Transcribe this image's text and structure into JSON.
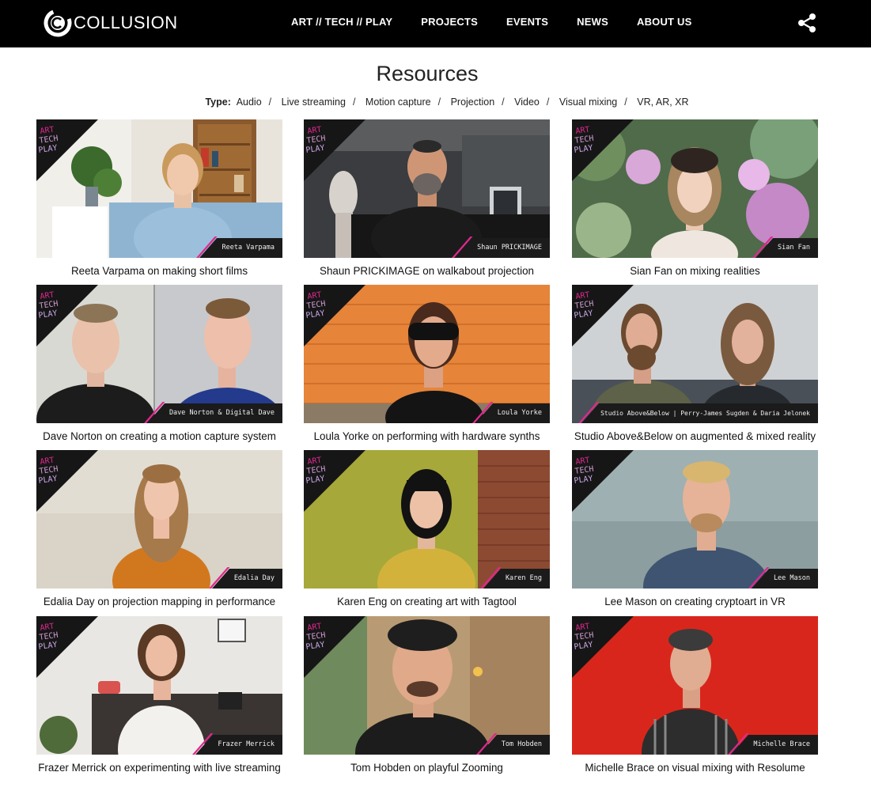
{
  "site": {
    "logo_text": "COLLUSION",
    "nav": [
      "ART // TECH // PLAY",
      "PROJECTS",
      "EVENTS",
      "NEWS",
      "ABOUT US"
    ],
    "share_icon": "share-icon"
  },
  "page": {
    "title": "Resources",
    "filter_label": "Type:",
    "filters": [
      "Audio",
      "Live streaming",
      "Motion capture",
      "Projection",
      "Video",
      "Visual mixing",
      "VR, AR, XR"
    ]
  },
  "badge_text": [
    "ART",
    "TECH",
    "PLAY"
  ],
  "colors": {
    "header_bg": "#000000",
    "accent_pink": "#e0288f",
    "tag_bg": "#1b1b1b"
  },
  "resources": [
    {
      "title": "Reeta Varpama on making short films",
      "tag": "Reeta Varpama"
    },
    {
      "title": "Shaun PRICKIMAGE on walkabout projection",
      "tag": "Shaun PRICKIMAGE"
    },
    {
      "title": "Sian Fan on mixing realities",
      "tag": "Sian Fan"
    },
    {
      "title": "Dave Norton on creating a motion capture system",
      "tag": "Dave Norton & Digital Dave"
    },
    {
      "title": "Loula Yorke on performing with hardware synths",
      "tag": "Loula Yorke"
    },
    {
      "title": "Studio Above&Below on augmented & mixed reality",
      "tag": "Studio Above&Below | Perry-James Sugden & Daria Jelonek"
    },
    {
      "title": "Edalia Day on projection mapping in performance",
      "tag": "Edalia Day"
    },
    {
      "title": "Karen Eng on creating art with Tagtool",
      "tag": "Karen Eng"
    },
    {
      "title": "Lee Mason on creating cryptoart in VR",
      "tag": "Lee Mason"
    },
    {
      "title": "Frazer Merrick on experimenting with live streaming",
      "tag": "Frazer Merrick"
    },
    {
      "title": "Tom Hobden on playful Zooming",
      "tag": "Tom Hobden"
    },
    {
      "title": "Michelle Brace on visual mixing with Resolume",
      "tag": "Michelle Brace"
    }
  ]
}
